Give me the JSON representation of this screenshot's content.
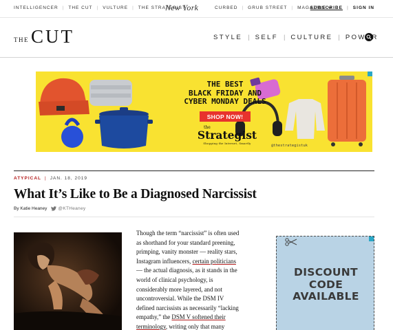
{
  "topnav": {
    "left_links": [
      "INTELLIGENCER",
      "THE CUT",
      "VULTURE",
      "THE STRATEGIST"
    ],
    "logo": "NEW YORK",
    "right_links": [
      "CURBED",
      "GRUB STREET",
      "MAGAZINE"
    ],
    "subscribe": "SUBSCRIBE",
    "signin": "SIGN IN"
  },
  "header": {
    "logo_the": "THE",
    "logo_cut": "CUT",
    "sections": [
      "STYLE",
      "SELF",
      "CULTURE",
      "POWER"
    ]
  },
  "banner_ad": {
    "headline_1": "THE BEST",
    "headline_2": "BLACK FRIDAY AND",
    "headline_3": "CYBER MONDAY DEALS",
    "button": "SHOP NOW!",
    "brand_the": "the",
    "brand_name": "Strategist",
    "tagline": "Shopping the Internet, Smartly",
    "handle": "@thestrategistuk",
    "colors": {
      "background": "#f9e231",
      "button": "#e8332d"
    }
  },
  "article": {
    "rubric": "ATYPICAL",
    "date": "JAN. 18, 2019",
    "title": "What It’s Like to Be a Diagnosed Narcissist",
    "author": "By Katie Heaney",
    "twitter": "@KTHeaney",
    "body": {
      "l1": "Though the term “narcissist” is often used",
      "l2": "as shorthand for your standard preening,",
      "l3": "primping, vanity monster — reality stars,",
      "l4_pre": "Instagram influencers, ",
      "l4_link": "certain politicians",
      "l5": "— the actual diagnosis, as it stands in the",
      "l6": "world of clinical psychology, is",
      "l7": "considerably more layered, and not",
      "l8": "uncontroversial. While the DSM IV",
      "l9": "defined narcissists as necessarily “lacking",
      "l10_pre": "empathy,” the ",
      "l10_link": "DSM V softened their",
      "l11_link": "terminology",
      "l11_post": ", writing only that many"
    }
  },
  "side_ad": {
    "line1": "DISCOUNT",
    "line2": "CODE",
    "line3": "AVAILABLE",
    "colors": {
      "background": "#b9d3e5"
    }
  },
  "colors": {
    "accent": "#b31b1b"
  }
}
